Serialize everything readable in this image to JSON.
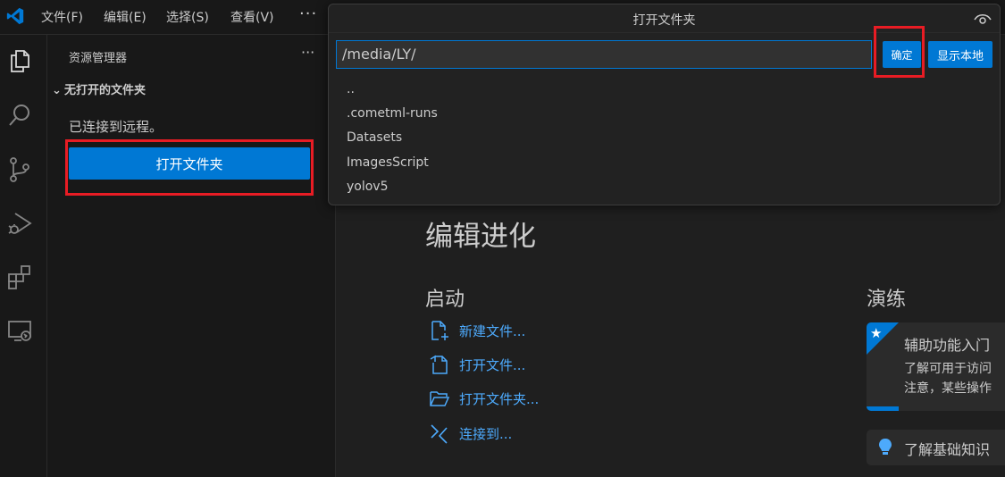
{
  "menu": {
    "items": [
      "文件(F)",
      "编辑(E)",
      "选择(S)",
      "查看(V)"
    ],
    "more": "···"
  },
  "sidebar": {
    "title": "资源管理器",
    "more": "···",
    "section_header": "无打开的文件夹",
    "connected_text": "已连接到远程。",
    "open_folder_button": "打开文件夹"
  },
  "quick_input": {
    "title": "打开文件夹",
    "input_value": "/media/LY/",
    "ok_button": "确定",
    "show_local_button": "显示本地",
    "items": [
      "..",
      ".cometml-runs",
      "Datasets",
      "ImagesScript",
      "yolov5"
    ]
  },
  "welcome": {
    "title": "编辑进化",
    "start_heading": "启动",
    "start_items": [
      {
        "label": "新建文件...",
        "icon": "new-file-icon"
      },
      {
        "label": "打开文件...",
        "icon": "open-file-icon"
      },
      {
        "label": "打开文件夹...",
        "icon": "open-folder-icon"
      },
      {
        "label": "连接到...",
        "icon": "remote-connect-icon"
      }
    ],
    "practice_heading": "演练",
    "cards": [
      {
        "title": "辅助功能入门",
        "desc_line1": "了解可用于访问",
        "desc_line2": "注意，某些操作"
      },
      {
        "title": "了解基础知识"
      }
    ]
  },
  "colors": {
    "accent": "#0078d4",
    "link": "#4daafc",
    "highlight": "#e81c24"
  }
}
